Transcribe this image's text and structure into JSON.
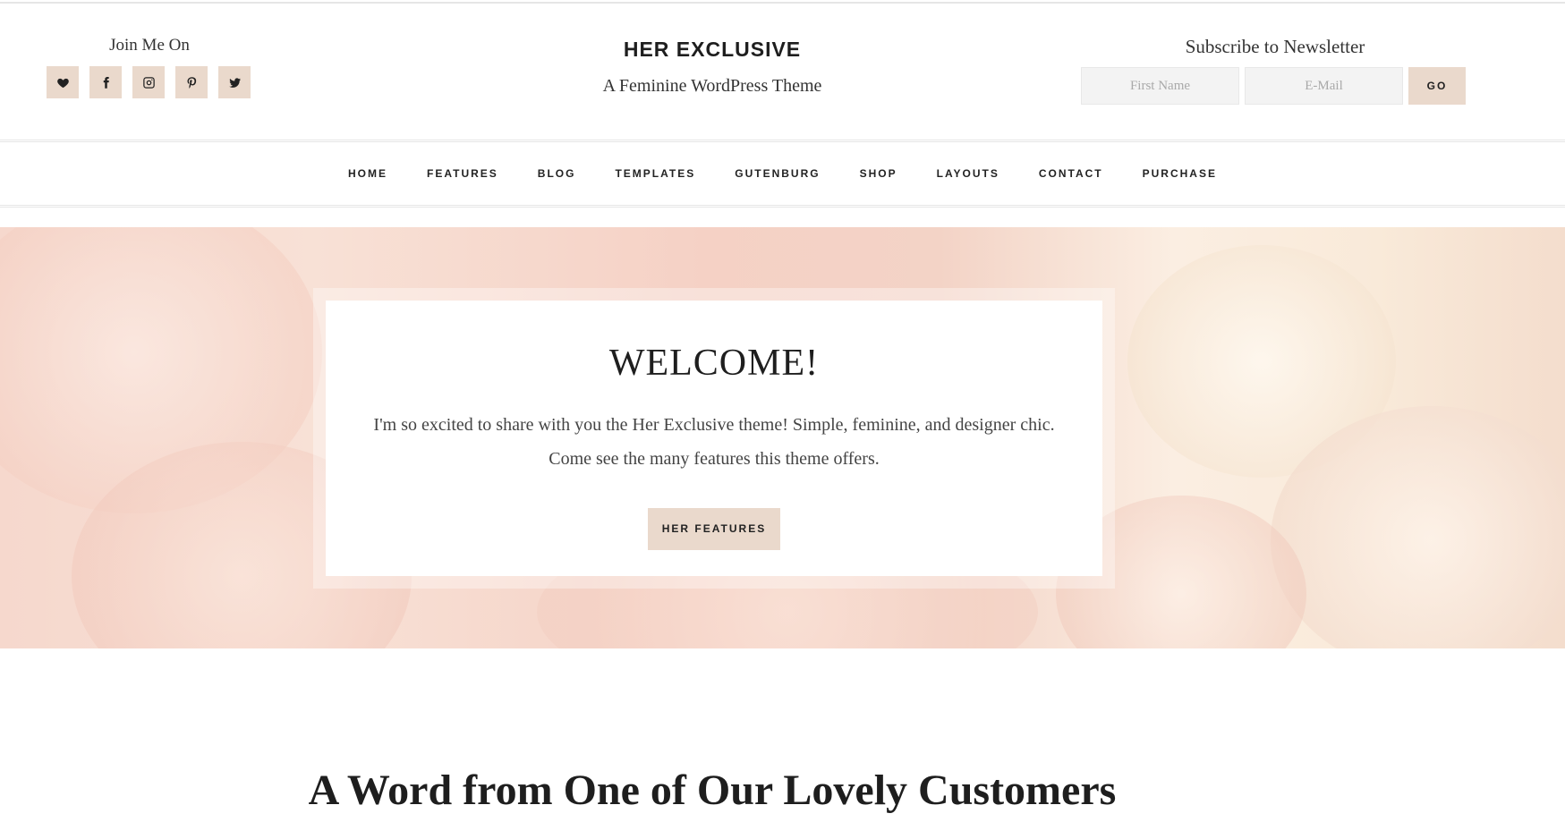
{
  "social": {
    "title": "Join Me On",
    "icons": [
      "heart-icon",
      "facebook-icon",
      "instagram-icon",
      "pinterest-icon",
      "twitter-icon"
    ]
  },
  "brand": {
    "title": "HER EXCLUSIVE",
    "tagline": "A Feminine WordPress Theme"
  },
  "newsletter": {
    "title": "Subscribe to Newsletter",
    "first_name_placeholder": "First Name",
    "email_placeholder": "E-Mail",
    "go_label": "GO"
  },
  "nav": {
    "items": [
      "HOME",
      "FEATURES",
      "BLOG",
      "TEMPLATES",
      "GUTENBURG",
      "SHOP",
      "LAYOUTS",
      "CONTACT",
      "PURCHASE"
    ]
  },
  "hero": {
    "title": "WELCOME!",
    "text": "I'm so excited to share with you the Her Exclusive theme! Simple, feminine, and designer chic. Come see the many features this theme offers.",
    "button_label": "HER FEATURES"
  },
  "section": {
    "title": "A Word from One of Our Lovely Customers"
  },
  "colors": {
    "accent": "#ead9cc",
    "text": "#222222"
  }
}
